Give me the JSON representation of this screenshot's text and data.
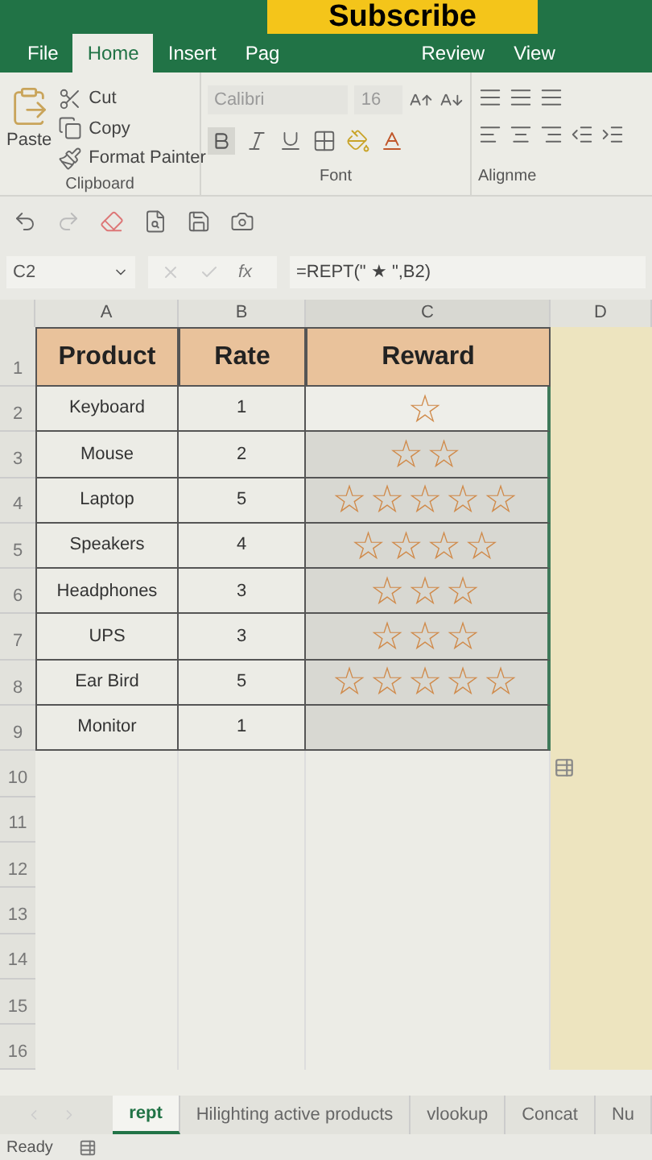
{
  "overlay": {
    "text": "Subscribe"
  },
  "ribbon_tabs": [
    {
      "label": "File",
      "selected": false
    },
    {
      "label": "Home",
      "selected": true
    },
    {
      "label": "Insert",
      "selected": false
    },
    {
      "label": "Pag",
      "selected": false
    },
    {
      "label": "Review",
      "selected": false
    },
    {
      "label": "View",
      "selected": false
    }
  ],
  "clipboard": {
    "paste": "Paste",
    "cut": "Cut",
    "copy": "Copy",
    "format_painter": "Format Painter",
    "group": "Clipboard"
  },
  "font": {
    "name": "Calibri",
    "size": "16",
    "group": "Font"
  },
  "alignment": {
    "group": "Alignme"
  },
  "formula_bar": {
    "name_box": "C2",
    "fx": "fx",
    "formula": "=REPT(\" ★ \",B2)"
  },
  "columns": [
    "A",
    "B",
    "C",
    "D"
  ],
  "header_row": {
    "number": "1",
    "cells": [
      "Product",
      "Rate",
      "Reward"
    ]
  },
  "rows": [
    {
      "number": "2",
      "product": "Keyboard",
      "rate": "1",
      "reward": "☆",
      "selected": false
    },
    {
      "number": "3",
      "product": "Mouse",
      "rate": "2",
      "reward": "☆☆",
      "selected": true
    },
    {
      "number": "4",
      "product": "Laptop",
      "rate": "5",
      "reward": "☆☆☆☆☆",
      "selected": true
    },
    {
      "number": "5",
      "product": "Speakers",
      "rate": "4",
      "reward": "☆☆☆☆",
      "selected": true
    },
    {
      "number": "6",
      "product": "Headphones",
      "rate": "3",
      "reward": "☆☆☆",
      "selected": true
    },
    {
      "number": "7",
      "product": "UPS",
      "rate": "3",
      "reward": "☆☆☆",
      "selected": true
    },
    {
      "number": "8",
      "product": "Ear Bird",
      "rate": "5",
      "reward": "☆☆☆☆☆",
      "selected": true
    },
    {
      "number": "9",
      "product": "Monitor",
      "rate": "1",
      "selected": true
    }
  ],
  "empty_rows": [
    "10",
    "11",
    "12",
    "13",
    "14",
    "15",
    "16"
  ],
  "sheet_tabs": [
    {
      "label": "rept",
      "selected": true
    },
    {
      "label": "Hilighting active products",
      "selected": false
    },
    {
      "label": "vlookup",
      "selected": false
    },
    {
      "label": "Concat",
      "selected": false
    },
    {
      "label": "Nu",
      "selected": false
    }
  ],
  "status_bar": {
    "text": "Ready"
  }
}
